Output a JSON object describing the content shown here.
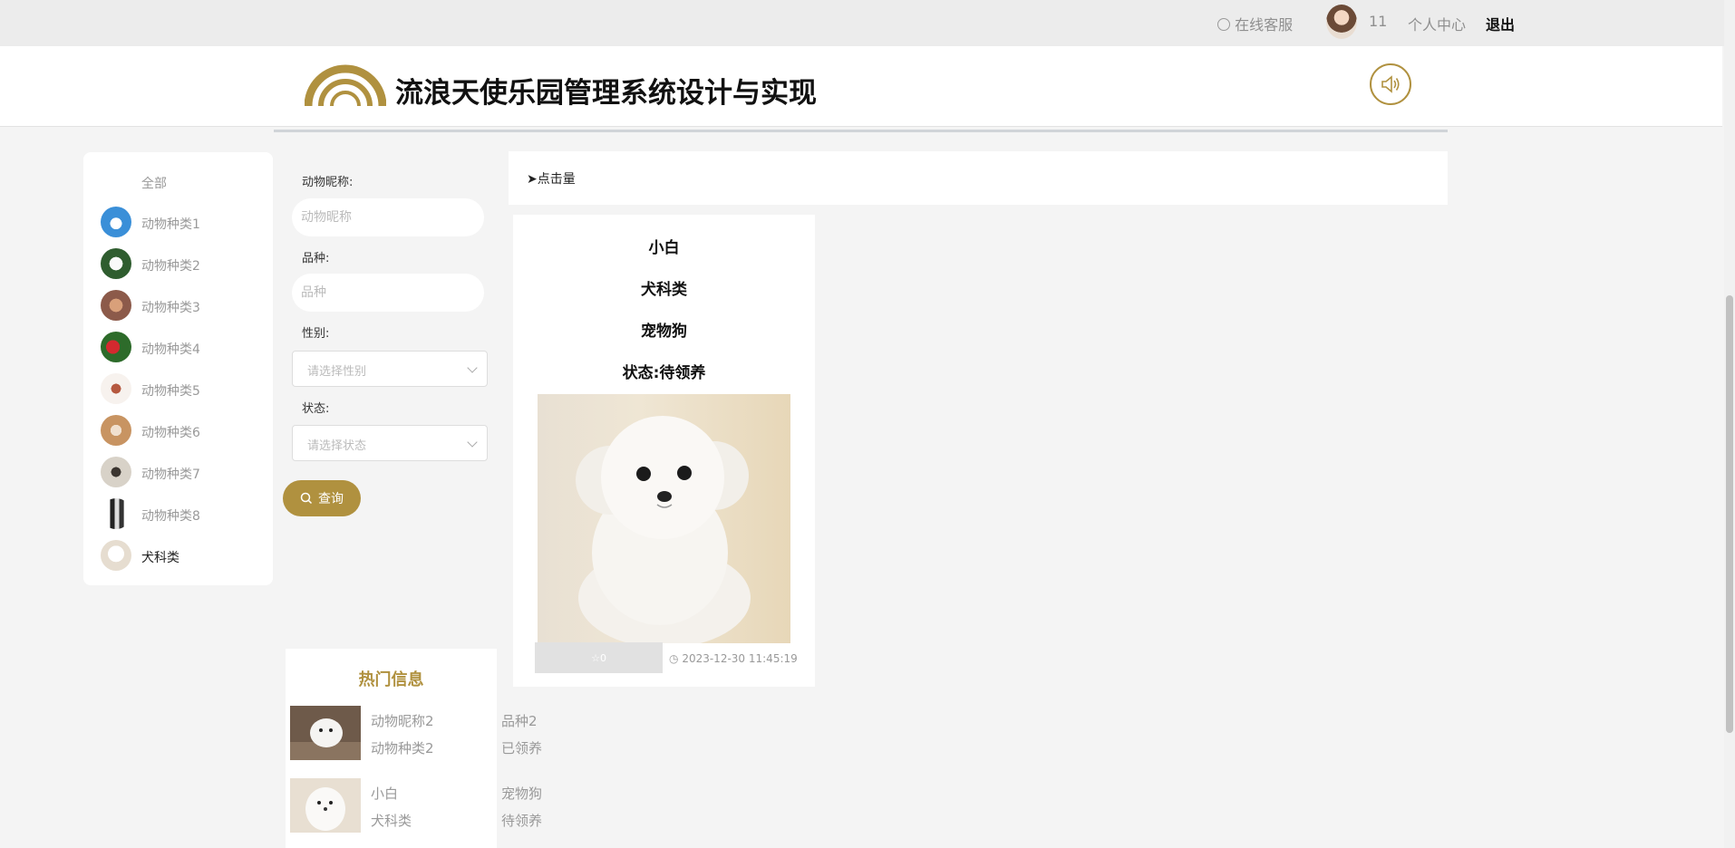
{
  "topbar": {
    "service": "在线客服",
    "count": "11",
    "personal_center": "个人中心",
    "logout": "退出"
  },
  "header": {
    "title": "流浪天使乐园管理系统设计与实现"
  },
  "categories": {
    "all": "全部",
    "items": [
      {
        "label": "动物种类1"
      },
      {
        "label": "动物种类2"
      },
      {
        "label": "动物种类3"
      },
      {
        "label": "动物种类4"
      },
      {
        "label": "动物种类5"
      },
      {
        "label": "动物种类6"
      },
      {
        "label": "动物种类7"
      },
      {
        "label": "动物种类8"
      },
      {
        "label": "犬科类"
      }
    ]
  },
  "search": {
    "nickname_label": "动物昵称:",
    "nickname_placeholder": "动物昵称",
    "breed_label": "品种:",
    "breed_placeholder": "品种",
    "gender_label": "性别:",
    "gender_placeholder": "请选择性别",
    "status_label": "状态:",
    "status_placeholder": "请选择状态",
    "button": "查询"
  },
  "sort": {
    "label": "➤点击量"
  },
  "card": {
    "name": "小白",
    "category": "犬科类",
    "breed": "宠物狗",
    "status": "状态:待领养",
    "likes": "0",
    "time": "2023-12-30 11:45:19"
  },
  "hot": {
    "title": "热门信息",
    "items": [
      {
        "name": "动物昵称2",
        "category": "动物种类2",
        "breed": "品种2",
        "status": "已领养"
      },
      {
        "name": "小白",
        "category": "犬科类",
        "breed": "宠物狗",
        "status": "待领养"
      }
    ]
  },
  "colors": {
    "accent": "#b0913f",
    "topbar": "#ececec"
  }
}
